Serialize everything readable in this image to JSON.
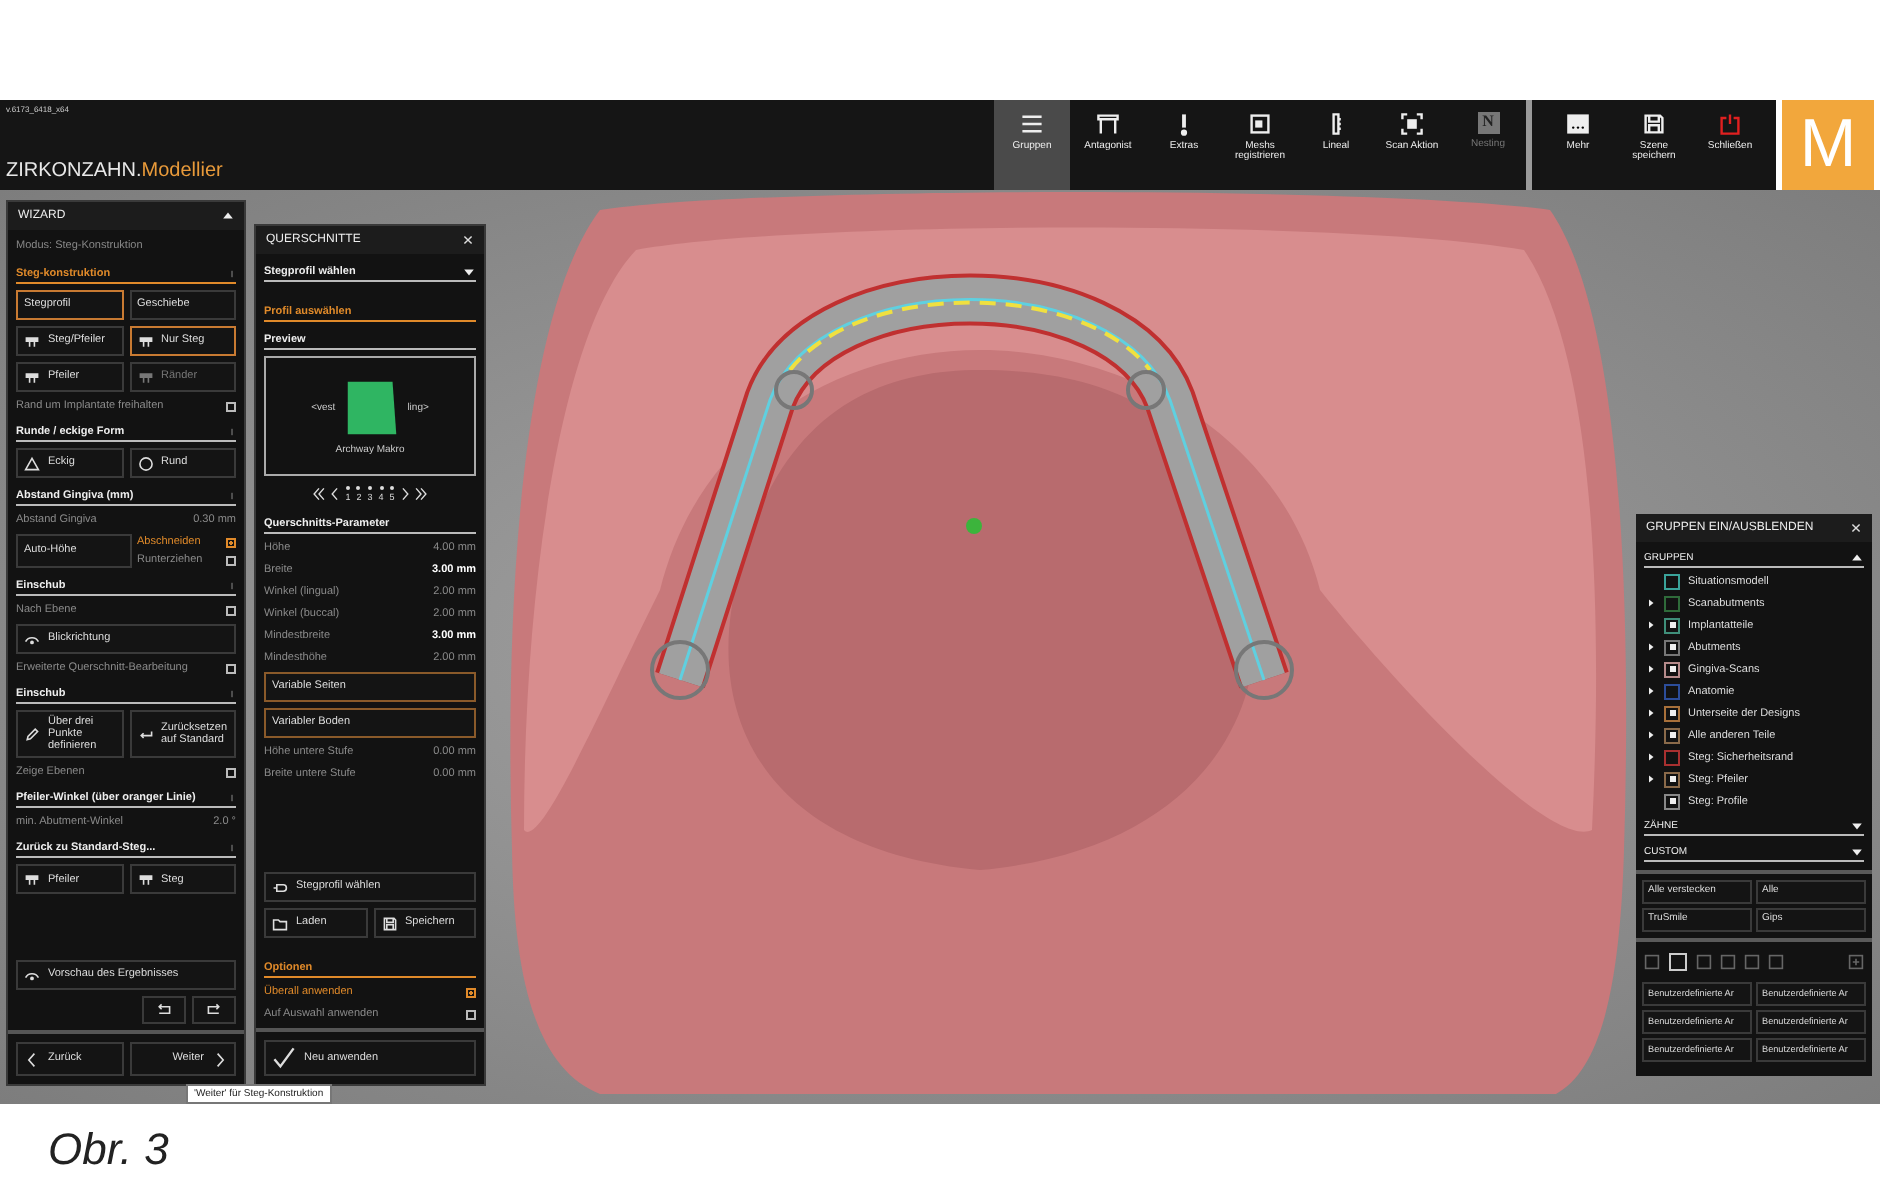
{
  "app": {
    "version": "v.6173_6418_x64",
    "brand": "ZIRKONZAHN.",
    "product": "Modellier",
    "toolbar": [
      {
        "label": "Gruppen",
        "selected": true,
        "disabled": false
      },
      {
        "label": "Antagonist",
        "selected": false,
        "disabled": false
      },
      {
        "label": "Extras",
        "selected": false,
        "disabled": false
      },
      {
        "label": "Meshs registrieren",
        "selected": false,
        "disabled": false
      },
      {
        "label": "Lineal",
        "selected": false,
        "disabled": false
      },
      {
        "label": "Scan Aktion",
        "selected": false,
        "disabled": false
      },
      {
        "label": "Nesting",
        "selected": false,
        "disabled": true,
        "glyph": "N"
      }
    ],
    "toolbar_right": [
      {
        "label": "Mehr"
      },
      {
        "label": "Szene speichern"
      },
      {
        "label": "Schließen"
      }
    ],
    "logo": "M"
  },
  "wizard": {
    "title": "WIZARD",
    "mode": "Modus: Steg-Konstruktion",
    "rows": [
      {
        "kind": "section",
        "label": "Steg-konstruktion",
        "active": true
      },
      {
        "kind": "buttons",
        "items": [
          {
            "label": "Stegprofil",
            "selected": true,
            "disabled": false
          },
          {
            "label": "Geschiebe",
            "selected": false,
            "disabled": false
          }
        ]
      },
      {
        "kind": "buttons",
        "items": [
          {
            "label": "Steg/Pfeiler",
            "selected": false,
            "disabled": false
          },
          {
            "label": "Nur Steg",
            "selected": true,
            "disabled": false
          }
        ]
      },
      {
        "kind": "buttons",
        "items": [
          {
            "label": "Pfeiler",
            "selected": false,
            "disabled": false
          },
          {
            "label": "Ränder",
            "selected": false,
            "disabled": true
          }
        ]
      },
      {
        "kind": "check",
        "label": "Rand um Implantate freihalten",
        "checked": false
      },
      {
        "kind": "section",
        "label": "Runde / eckige Form",
        "active": false
      },
      {
        "kind": "buttons",
        "items": [
          {
            "label": "Eckig",
            "selected": false,
            "disabled": false
          },
          {
            "label": "Rund",
            "selected": false,
            "disabled": false
          }
        ]
      },
      {
        "kind": "section",
        "label": "Abstand Gingiva (mm)",
        "active": false
      },
      {
        "kind": "value",
        "label": "Abstand Gingiva",
        "value": "0.30 mm"
      },
      {
        "kind": "options",
        "button": "Auto-Höhe",
        "options": [
          {
            "label": "Abschneiden",
            "checked": true
          },
          {
            "label": "Runterziehen",
            "checked": false
          }
        ]
      },
      {
        "kind": "section",
        "label": "Einschub",
        "active": false
      },
      {
        "kind": "check",
        "label": "Nach Ebene",
        "checked": false
      },
      {
        "kind": "wide",
        "label": "Blickrichtung"
      },
      {
        "kind": "check",
        "label": "Erweiterte Querschnitt-Bearbeitung",
        "checked": false
      },
      {
        "kind": "section",
        "label": "Einschub",
        "active": false
      },
      {
        "kind": "buttons",
        "items": [
          {
            "label": "Über drei Punkte definieren",
            "selected": false,
            "disabled": false
          },
          {
            "label": "Zurücksetzen auf Standard",
            "selected": false,
            "disabled": false
          }
        ]
      },
      {
        "kind": "check",
        "label": "Zeige Ebenen",
        "checked": false
      },
      {
        "kind": "section",
        "label": "Pfeiler-Winkel (über oranger Linie)",
        "active": false
      },
      {
        "kind": "value",
        "label": "min. Abutment-Winkel",
        "value": "2.0 °"
      },
      {
        "kind": "section",
        "label": "Zurück zu Standard-Steg...",
        "active": false
      },
      {
        "kind": "buttons",
        "items": [
          {
            "label": "Pfeiler",
            "selected": false,
            "disabled": false
          },
          {
            "label": "Steg",
            "selected": false,
            "disabled": false
          }
        ]
      }
    ],
    "preview_button": "Vorschau des Ergebnisses",
    "back": "Zurück",
    "next": "Weiter"
  },
  "cross_sections": {
    "title": "QUERSCHNITTE",
    "dropdown": "Stegprofil wählen",
    "profile_heading": "Profil auswählen",
    "preview_heading": "Preview",
    "preview": {
      "left": "<vest",
      "right": "ling>",
      "name": "Archway Makro"
    },
    "pages": [
      "1",
      "2",
      "3",
      "4",
      "5"
    ],
    "params_heading": "Querschnitts-Parameter",
    "params": [
      {
        "kind": "param",
        "label": "Höhe",
        "value": "4.00 mm",
        "emphasized": false
      },
      {
        "kind": "param",
        "label": "Breite",
        "value": "3.00 mm",
        "emphasized": true
      },
      {
        "kind": "param",
        "label": "Winkel (lingual)",
        "value": "2.00 mm",
        "emphasized": false
      },
      {
        "kind": "param",
        "label": "Winkel (buccal)",
        "value": "2.00 mm",
        "emphasized": false
      },
      {
        "kind": "param",
        "label": "Mindestbreite",
        "value": "3.00 mm",
        "emphasized": true
      },
      {
        "kind": "param",
        "label": "Mindesthöhe",
        "value": "2.00 mm",
        "emphasized": false
      },
      {
        "kind": "toggle",
        "label": "Variable Seiten"
      },
      {
        "kind": "toggle",
        "label": "Variabler Boden"
      },
      {
        "kind": "param",
        "label": "Höhe untere Stufe",
        "value": "0.00 mm",
        "emphasized": false
      },
      {
        "kind": "param",
        "label": "Breite untere Stufe",
        "value": "0.00 mm",
        "emphasized": false
      }
    ],
    "actions": [
      "Stegprofil wählen",
      "Laden",
      "Speichern"
    ],
    "options_heading": "Optionen",
    "options": [
      {
        "label": "Überall anwenden",
        "checked": true
      },
      {
        "label": "Auf Auswahl anwenden",
        "checked": false
      }
    ],
    "apply_button": "Neu anwenden"
  },
  "groups_panel": {
    "title": "GRUPPEN EIN/AUSBLENDEN",
    "sections": [
      {
        "label": "GRUPPEN",
        "expanded": true,
        "items": [
          {
            "label": "Situationsmodell",
            "expandable": false,
            "checked": false,
            "color": "#3aa39a"
          },
          {
            "label": "Scanabutments",
            "expandable": true,
            "checked": false,
            "color": "#2f6b3a"
          },
          {
            "label": "Implantatteile",
            "expandable": true,
            "checked": true,
            "color": "#3f8f7a"
          },
          {
            "label": "Abutments",
            "expandable": true,
            "checked": true,
            "color": "#777777"
          },
          {
            "label": "Gingiva-Scans",
            "expandable": true,
            "checked": true,
            "color": "#b58a8a"
          },
          {
            "label": "Anatomie",
            "expandable": true,
            "checked": false,
            "color": "#2c4d9a"
          },
          {
            "label": "Unterseite der Designs",
            "expandable": true,
            "checked": true,
            "color": "#a8703a"
          },
          {
            "label": "Alle anderen Teile",
            "expandable": true,
            "checked": true,
            "color": "#8a6a4a"
          },
          {
            "label": "Steg: Sicherheitsrand",
            "expandable": true,
            "checked": false,
            "color": "#a83030"
          },
          {
            "label": "Steg: Pfeiler",
            "expandable": true,
            "checked": true,
            "color": "#8a6a4a"
          },
          {
            "label": "Steg: Profile",
            "expandable": false,
            "checked": true,
            "color": "#888888"
          }
        ]
      },
      {
        "label": "ZÄHNE",
        "expanded": false
      },
      {
        "label": "CUSTOM",
        "expanded": false
      }
    ],
    "buttons": [
      "Alle verstecken",
      "Alle",
      "TruSmile",
      "Gips"
    ],
    "slots": [
      {
        "selected": false
      },
      {
        "selected": true
      },
      {
        "selected": false
      },
      {
        "selected": false
      },
      {
        "selected": false
      },
      {
        "selected": false
      }
    ],
    "presets": [
      "Benutzerdefinierte Ar",
      "Benutzerdefinierte Ar",
      "Benutzerdefinierte Ar",
      "Benutzerdefinierte Ar",
      "Benutzerdefinierte Ar",
      "Benutzerdefinierte Ar"
    ]
  },
  "tooltip": "'Weiter' für Steg-Konstruktion",
  "caption": "Obr. 3"
}
